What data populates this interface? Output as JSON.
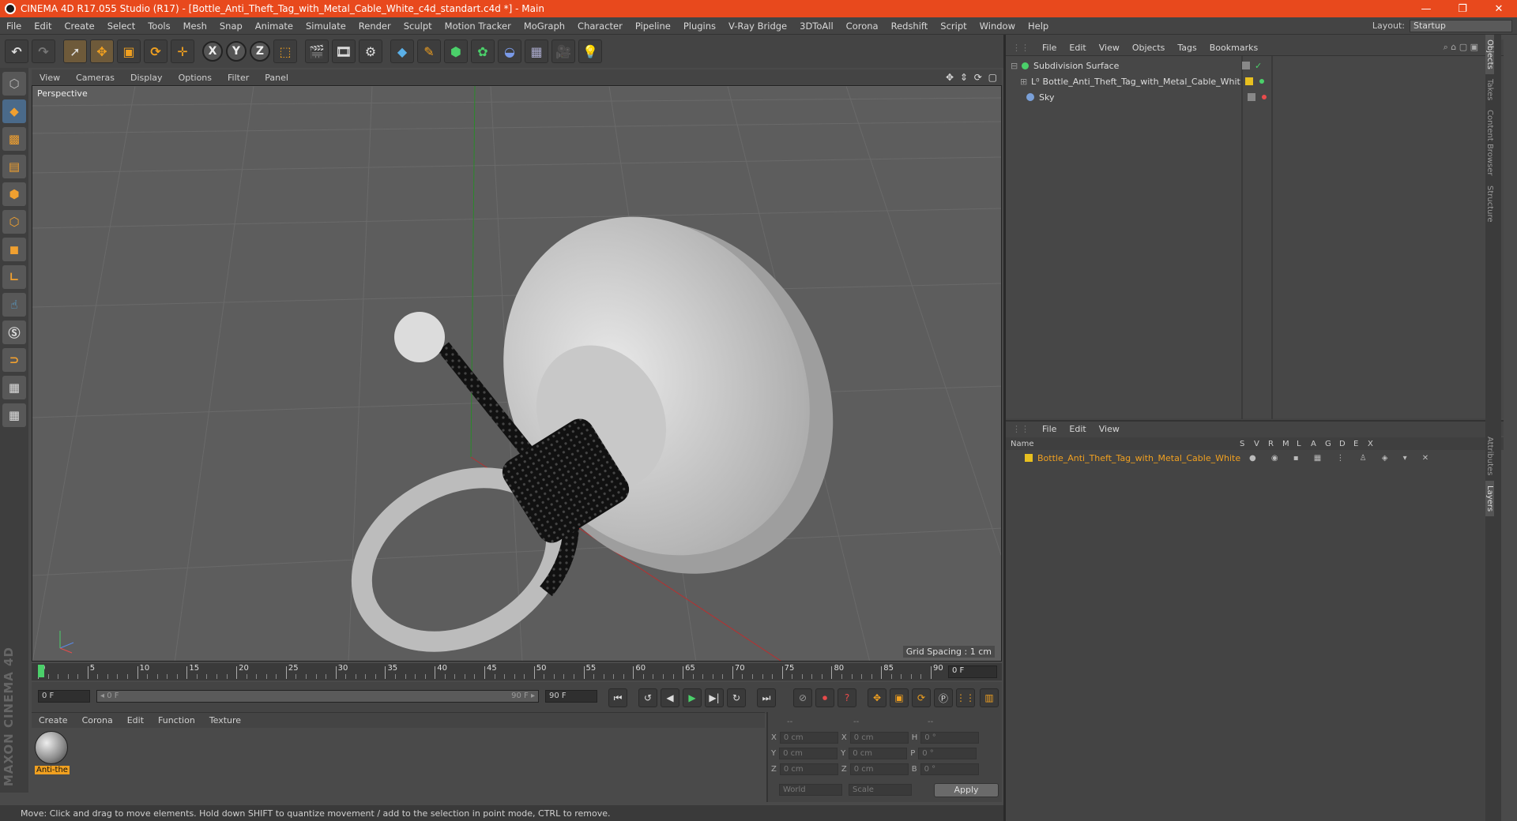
{
  "titlebar": {
    "title": "CINEMA 4D R17.055 Studio (R17) - [Bottle_Anti_Theft_Tag_with_Metal_Cable_White_c4d_standart.c4d *] - Main",
    "minimize": "—",
    "restore": "❐",
    "close": "✕"
  },
  "menubar": {
    "items": [
      "File",
      "Edit",
      "Create",
      "Select",
      "Tools",
      "Mesh",
      "Snap",
      "Animate",
      "Simulate",
      "Render",
      "Sculpt",
      "Motion Tracker",
      "MoGraph",
      "Character",
      "Pipeline",
      "Plugins",
      "V-Ray Bridge",
      "3DToAll",
      "Corona",
      "Redshift",
      "Script",
      "Window",
      "Help"
    ],
    "layout_label": "Layout:",
    "layout_value": "Startup"
  },
  "toolbar": {
    "axis_x": "X",
    "axis_y": "Y",
    "axis_z": "Z"
  },
  "viewport": {
    "menu": [
      "View",
      "Cameras",
      "Display",
      "Options",
      "Filter",
      "Panel"
    ],
    "label": "Perspective",
    "grid_spacing": "Grid Spacing : 1 cm",
    "nav_icons": "✥ ⇕ ⟳ ▢"
  },
  "timeline": {
    "ticks": [
      "0",
      "5",
      "10",
      "15",
      "20",
      "25",
      "30",
      "35",
      "40",
      "45",
      "50",
      "55",
      "60",
      "65",
      "70",
      "75",
      "80",
      "85",
      "90"
    ],
    "current_frame": "0 F"
  },
  "playbar": {
    "start": "0 F",
    "range_start": "◂ 0 F",
    "range_end": "90 F ▸",
    "end": "90 F"
  },
  "material_manager": {
    "menu": [
      "Create",
      "Corona",
      "Edit",
      "Function",
      "Texture"
    ],
    "material_label": "Anti-the"
  },
  "coordinates": {
    "header": [
      "--",
      "--",
      "--"
    ],
    "rows": [
      {
        "a": "X",
        "av": "0 cm",
        "b": "X",
        "bv": "0 cm",
        "c": "H",
        "cv": "0 °"
      },
      {
        "a": "Y",
        "av": "0 cm",
        "b": "Y",
        "bv": "0 cm",
        "c": "P",
        "cv": "0 °"
      },
      {
        "a": "Z",
        "av": "0 cm",
        "b": "Z",
        "bv": "0 cm",
        "c": "B",
        "cv": "0 °"
      }
    ],
    "world": "World",
    "scale": "Scale",
    "apply": "Apply"
  },
  "statusbar": {
    "text": "Move: Click and drag to move elements. Hold down SHIFT to quantize movement / add to the selection in point mode, CTRL to remove."
  },
  "object_manager": {
    "menu": [
      "File",
      "Edit",
      "View",
      "Objects",
      "Tags",
      "Bookmarks"
    ],
    "objects": [
      {
        "name": "Subdivision Surface"
      },
      {
        "name": "Bottle_Anti_Theft_Tag_with_Metal_Cable_White"
      },
      {
        "name": "Sky"
      }
    ]
  },
  "layer_manager": {
    "menu": [
      "File",
      "Edit",
      "View"
    ],
    "header_name": "Name",
    "columns": [
      "S",
      "V",
      "R",
      "M",
      "L",
      "A",
      "G",
      "D",
      "E",
      "X"
    ],
    "layer_name": "Bottle_Anti_Theft_Tag_with_Metal_Cable_White",
    "layer_color": "#e8c020"
  },
  "side_tabs": [
    "Objects",
    "Takes",
    "Content Browser",
    "Structure",
    "Attributes",
    "Layers"
  ],
  "colors": {
    "title_bar": "#e8491d",
    "accent": "#f0a020"
  },
  "maxon_logo": "MAXON CINEMA 4D"
}
